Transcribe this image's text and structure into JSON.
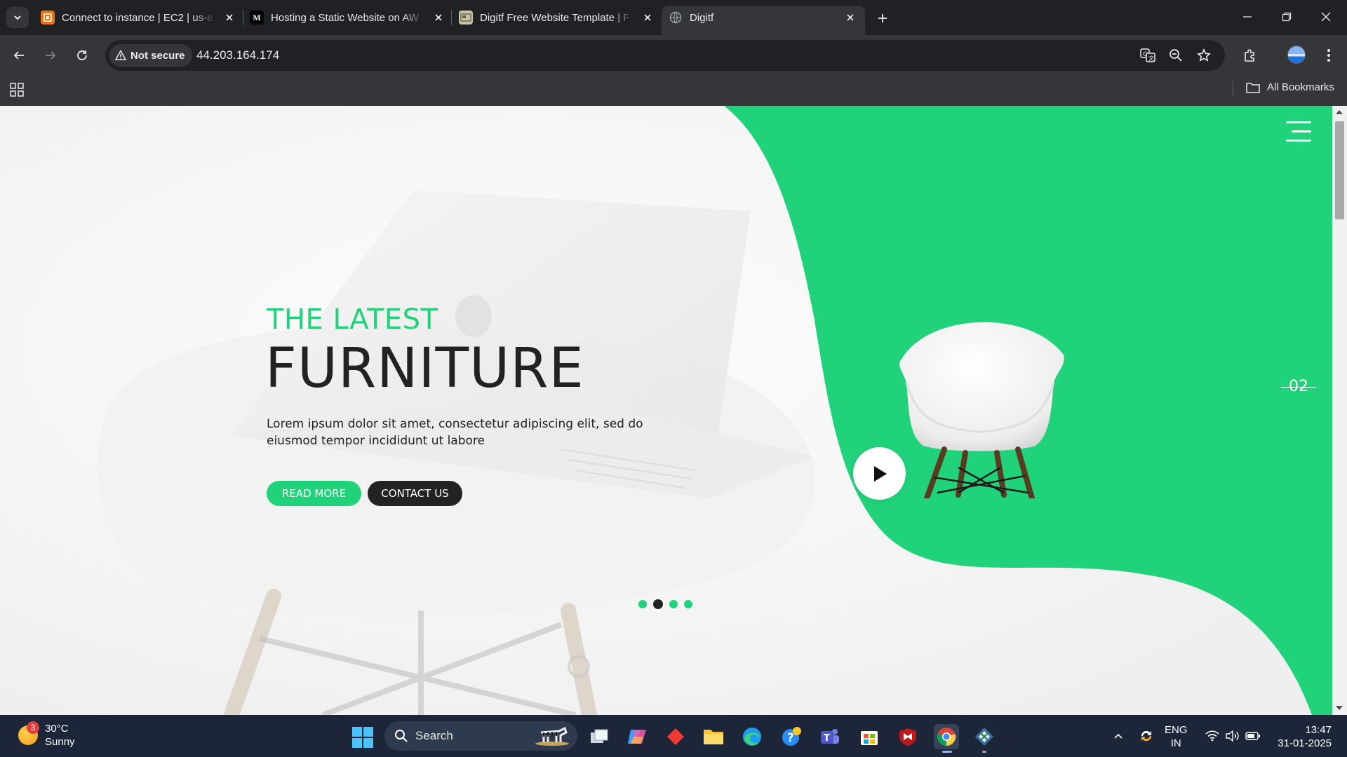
{
  "browser": {
    "tabs": [
      {
        "title": "Connect to instance | EC2 | us-e",
        "favicon": "aws-console-icon",
        "active": false
      },
      {
        "title": "Hosting a Static Website on AW",
        "favicon": "medium-icon",
        "favicon_text": "M",
        "active": false
      },
      {
        "title": "Digitf Free Website Template | F",
        "favicon": "template-icon",
        "active": false
      },
      {
        "title": "Digitf",
        "favicon": "globe-icon",
        "active": true
      }
    ],
    "security_label": "Not secure",
    "url": "44.203.164.174",
    "bookmarks_label": "All Bookmarks"
  },
  "page": {
    "accent": "#20d27a",
    "dark": "#222222",
    "eyebrow": "THE LATEST",
    "headline": "FURNITURE",
    "lede": "Lorem ipsum dolor sit amet, consectetur adipiscing elit, sed do eiusmod tempor incididunt ut labore",
    "read_more": "READ MORE",
    "contact_us": "CONTACT US",
    "slide_number": "02",
    "slider_dots": 4,
    "active_dot": 2
  },
  "taskbar": {
    "weather_temp": "30°C",
    "weather_desc": "Sunny",
    "weather_badge": "3",
    "search_label": "Search",
    "lang_line1": "ENG",
    "lang_line2": "IN",
    "time": "13:47",
    "date": "31-01-2025"
  }
}
